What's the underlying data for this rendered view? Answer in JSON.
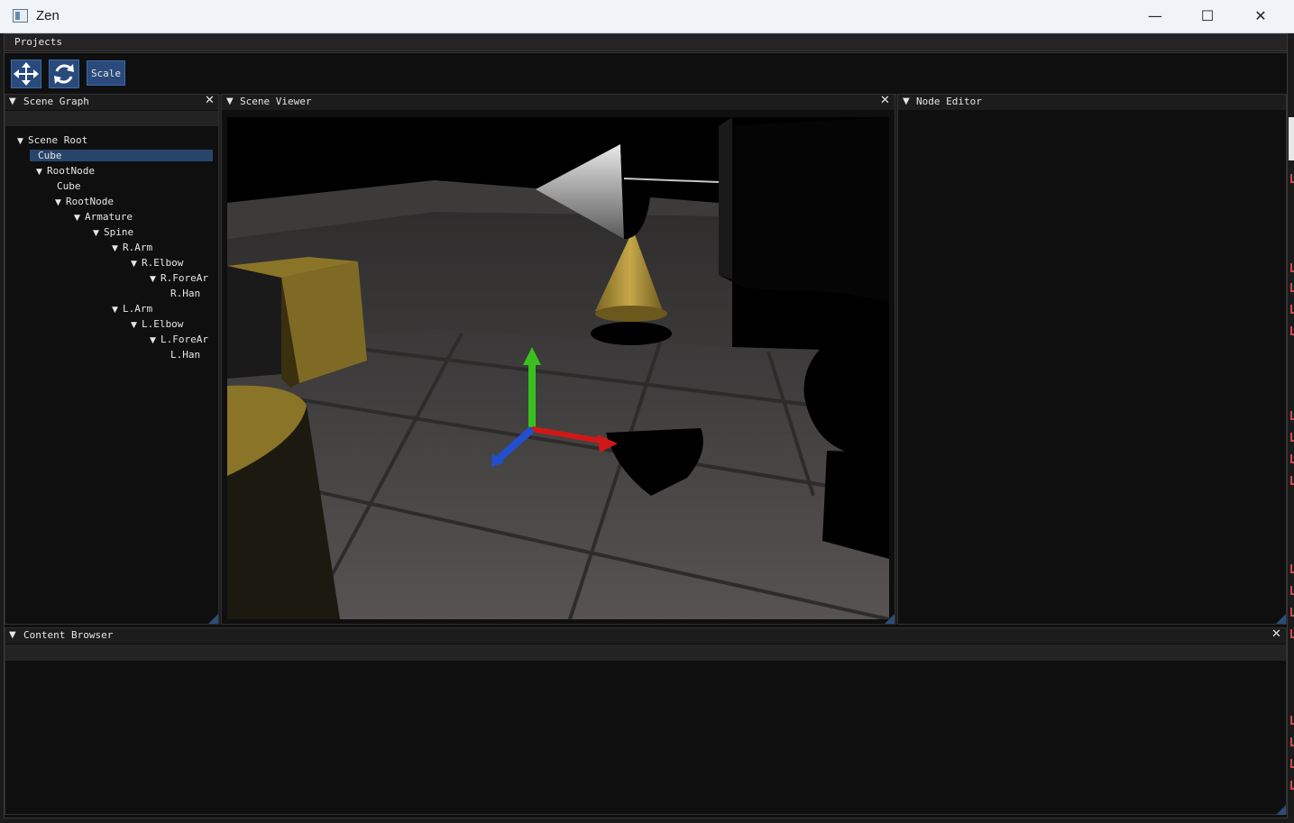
{
  "window": {
    "title": "Zen",
    "controls": {
      "minimize": "—",
      "maximize": "☐",
      "close": "✕"
    }
  },
  "menu": {
    "projects": "Projects"
  },
  "toolbar": {
    "translate_icon": "move-arrows-icon",
    "rotate_icon": "rotate-icon",
    "scale_label": "Scale"
  },
  "scene_graph": {
    "title": "Scene Graph",
    "items": [
      {
        "label": "Scene Root",
        "depth": 0,
        "expanded": true
      },
      {
        "label": "Cube",
        "depth": 1,
        "expanded": false,
        "selected": true
      },
      {
        "label": "RootNode",
        "depth": 1,
        "expanded": true
      },
      {
        "label": "Cube",
        "depth": 2,
        "expanded": false
      },
      {
        "label": "RootNode",
        "depth": 2,
        "expanded": true
      },
      {
        "label": "Armature",
        "depth": 3,
        "expanded": true
      },
      {
        "label": "Spine",
        "depth": 4,
        "expanded": true
      },
      {
        "label": "R.Arm",
        "depth": 5,
        "expanded": true
      },
      {
        "label": "R.Elbow",
        "depth": 6,
        "expanded": true
      },
      {
        "label": "R.ForeAr",
        "depth": 7,
        "expanded": true
      },
      {
        "label": "R.Han",
        "depth": 8,
        "expanded": false
      },
      {
        "label": "L.Arm",
        "depth": 5,
        "expanded": true
      },
      {
        "label": "L.Elbow",
        "depth": 6,
        "expanded": true
      },
      {
        "label": "L.ForeAr",
        "depth": 7,
        "expanded": true
      },
      {
        "label": "L.Han",
        "depth": 8,
        "expanded": false
      }
    ]
  },
  "scene_viewer": {
    "title": "Scene Viewer"
  },
  "node_editor": {
    "title": "Node Editor"
  },
  "content_browser": {
    "title": "Content Browser"
  },
  "colors": {
    "accent": "#294a7a",
    "selection": "#28446b",
    "axis_x": "#d01818",
    "axis_y": "#39c01f",
    "axis_z": "#2050d0",
    "object_gold": "#a88c30"
  }
}
